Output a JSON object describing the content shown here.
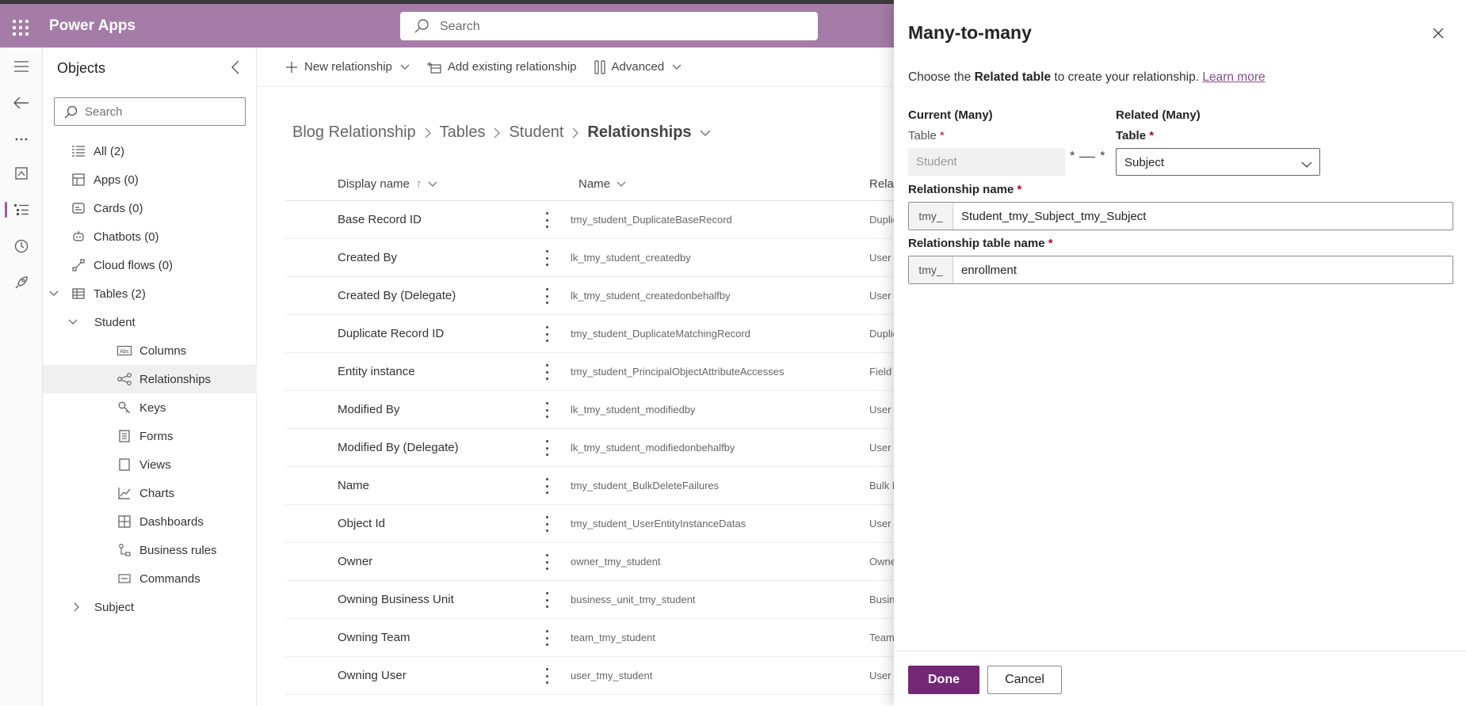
{
  "app": {
    "name": "Power Apps"
  },
  "top_search": {
    "placeholder": "Search"
  },
  "objects_panel": {
    "title": "Objects",
    "search_placeholder": "Search",
    "tree": [
      {
        "label": "All  (2)",
        "icon": "list-icon"
      },
      {
        "label": "Apps  (0)",
        "icon": "apps-icon"
      },
      {
        "label": "Cards  (0)",
        "icon": "card-icon"
      },
      {
        "label": "Chatbots  (0)",
        "icon": "bot-icon"
      },
      {
        "label": "Cloud flows  (0)",
        "icon": "flow-icon"
      },
      {
        "label": "Tables  (2)",
        "icon": "table-icon",
        "expanded": true
      },
      {
        "label": "Student",
        "expanded": true
      },
      {
        "label": "Columns",
        "icon": "abc-icon"
      },
      {
        "label": "Relationships",
        "icon": "relationship-icon",
        "selected": true
      },
      {
        "label": "Keys",
        "icon": "key-icon"
      },
      {
        "label": "Forms",
        "icon": "form-icon"
      },
      {
        "label": "Views",
        "icon": "view-icon"
      },
      {
        "label": "Charts",
        "icon": "chart-icon"
      },
      {
        "label": "Dashboards",
        "icon": "dashboard-icon"
      },
      {
        "label": "Business rules",
        "icon": "business-rule-icon"
      },
      {
        "label": "Commands",
        "icon": "command-icon"
      },
      {
        "label": "Subject",
        "expanded": false
      }
    ]
  },
  "command_bar": {
    "new_relationship": "New relationship",
    "add_existing": "Add existing relationship",
    "advanced": "Advanced"
  },
  "breadcrumb": [
    "Blog Relationship",
    "Tables",
    "Student",
    "Relationships"
  ],
  "table": {
    "headers": {
      "display_name": "Display name",
      "sort_indicator": "↑",
      "name": "Name",
      "related": "Relat"
    },
    "rows": [
      {
        "display": "Base Record ID",
        "name": "tmy_student_DuplicateBaseRecord",
        "related": "Duplic"
      },
      {
        "display": "Created By",
        "name": "lk_tmy_student_createdby",
        "related": "User"
      },
      {
        "display": "Created By (Delegate)",
        "name": "lk_tmy_student_createdonbehalfby",
        "related": "User"
      },
      {
        "display": "Duplicate Record ID",
        "name": "tmy_student_DuplicateMatchingRecord",
        "related": "Duplic"
      },
      {
        "display": "Entity instance",
        "name": "tmy_student_PrincipalObjectAttributeAccesses",
        "related": "Field S"
      },
      {
        "display": "Modified By",
        "name": "lk_tmy_student_modifiedby",
        "related": "User"
      },
      {
        "display": "Modified By (Delegate)",
        "name": "lk_tmy_student_modifiedonbehalfby",
        "related": "User"
      },
      {
        "display": "Name",
        "name": "tmy_student_BulkDeleteFailures",
        "related": "Bulk D"
      },
      {
        "display": "Object Id",
        "name": "tmy_student_UserEntityInstanceDatas",
        "related": "User E"
      },
      {
        "display": "Owner",
        "name": "owner_tmy_student",
        "related": "Owne"
      },
      {
        "display": "Owning Business Unit",
        "name": "business_unit_tmy_student",
        "related": "Busine"
      },
      {
        "display": "Owning Team",
        "name": "team_tmy_student",
        "related": "Team"
      },
      {
        "display": "Owning User",
        "name": "user_tmy_student",
        "related": "User"
      }
    ]
  },
  "dialog": {
    "title": "Many-to-many",
    "desc_prefix": "Choose the ",
    "desc_bold": "Related table",
    "desc_suffix": " to create your relationship.",
    "learn_more": "Learn more",
    "current_heading": "Current (Many)",
    "related_heading": "Related (Many)",
    "table_label": "Table",
    "required_mark": "*",
    "current_table_value": "Student",
    "relation_symbol_left": "*",
    "relation_symbol_right": "*",
    "related_table_value": "Subject",
    "rel_name_label": "Relationship name",
    "prefix": "tmy_",
    "rel_name_value": "Student_tmy_Subject_tmy_Subject",
    "rel_table_label": "Relationship table name",
    "rel_table_value": "enrollment",
    "done": "Done",
    "cancel": "Cancel"
  },
  "colors": {
    "topbar": "#a47ca7",
    "primary_button": "#742774",
    "link": "#8a4b8f",
    "required": "#b10e1c"
  }
}
